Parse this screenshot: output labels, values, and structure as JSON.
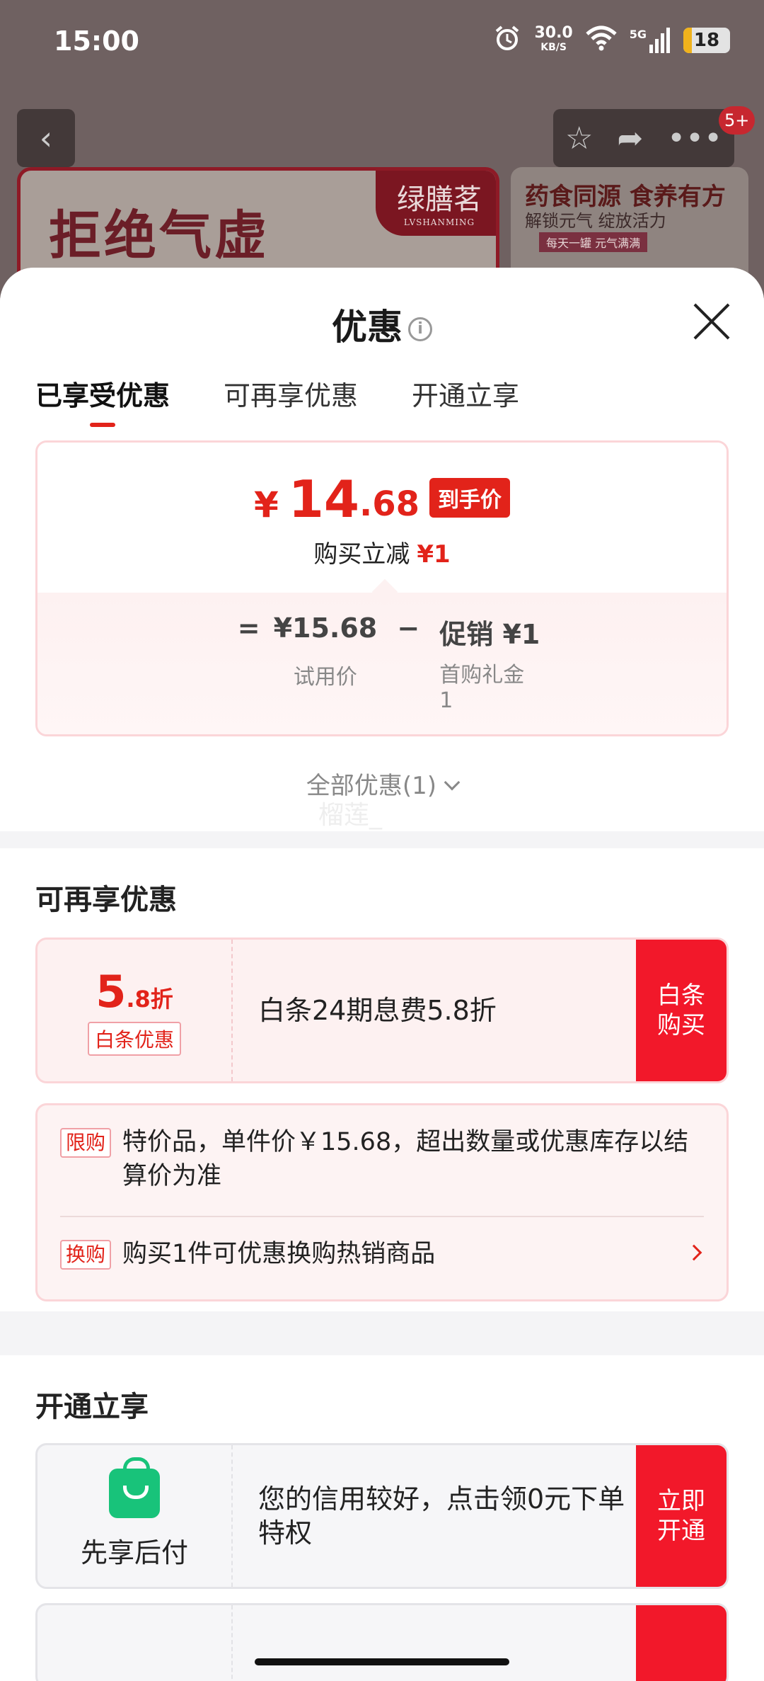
{
  "status_bar": {
    "time": "15:00",
    "speed_value": "30.0",
    "speed_unit": "KB/S",
    "network": "5G",
    "battery": "18"
  },
  "background": {
    "badge": "5+",
    "banner_left_text": "拒绝气虚",
    "banner_left_logo": "绿膳茗",
    "banner_left_logo_sub": "LVSHANMING",
    "banner_right_title": "药食同源 食养有方",
    "banner_right_sub": "解锁元气 绽放活力",
    "banner_right_tag": "每天一罐 元气满满"
  },
  "sheet": {
    "title": "优惠",
    "info_icon": "i",
    "tabs": [
      {
        "label": "已享受优惠",
        "active": true
      },
      {
        "label": "可再享优惠",
        "active": false
      },
      {
        "label": "开通立享",
        "active": false
      }
    ],
    "price_card": {
      "currency": "¥",
      "price_int": "14",
      "price_dec": ".68",
      "tag": "到手价",
      "sub_label": "购买立减",
      "sub_value": "¥1",
      "eq": "=",
      "base_price": "¥15.68",
      "base_label": "试用价",
      "minus": "−",
      "promo": "促销 ¥1",
      "promo_label": "首购礼金",
      "promo_label2": "1"
    },
    "all_discount": "全部优惠(1)",
    "watermark": "榴莲_"
  },
  "section_more": {
    "title": "可再享优惠",
    "coupon": {
      "disc_big": "5",
      "disc_small": ".8折",
      "tag": "白条优惠",
      "desc": "白条24期息费5.8折",
      "button": "白条\n购买"
    },
    "notice": {
      "row1_tag": "限购",
      "row1_text": "特价品，单件价￥15.68，超出数量或优惠库存以结算价为准",
      "row2_tag": "换购",
      "row2_text": "购买1件可优惠换购热销商品"
    }
  },
  "section_open": {
    "title": "开通立享",
    "coupon": {
      "label": "先享后付",
      "desc": "您的信用较好，点击领0元下单特权",
      "button": "立即\n开通"
    }
  },
  "colors": {
    "accent": "#e2231a",
    "button_red": "#f2182a",
    "green": "#18c37a"
  }
}
